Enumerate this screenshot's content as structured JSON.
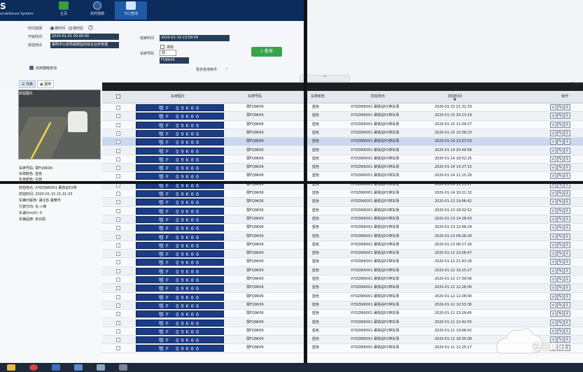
{
  "app": {
    "logo": "S",
    "subtitle": "urveillance System"
  },
  "nav": [
    {
      "label": "主页",
      "icon": "home-icon"
    },
    {
      "label": "实时视频",
      "icon": "camera-icon"
    },
    {
      "label": "卡口查询",
      "icon": "checkpoint-icon"
    }
  ],
  "search": {
    "time_select_label": "时间选择:",
    "radio_by_time": "按时间",
    "radio_by_segment": "按时段",
    "start_label": "开始时间",
    "start_value": "2020-01-01 00:00:00",
    "end_label": "结束时间",
    "end_value": "2020-01-19 23:59:59",
    "location_label": "抓拍地点",
    "location_value": "襄阳市公安局视频监控综合业务管理",
    "exclude_label": "排除",
    "plate_label": "车牌号码",
    "plate_prefix": "鄂",
    "plate_value": "FQ9K06",
    "fuzzy_label": "启用模糊查询",
    "more_conditions": "更多查询条件",
    "query_button": "查询"
  },
  "toolbar": {
    "tab_list": "列表",
    "tab_chart": "图表",
    "export": "导出所"
  },
  "preview": {
    "title": "抓拍图片"
  },
  "details_upper": [
    "车牌号码: 鄂FQ9K06",
    "车牌颜色: 蓝色",
    "车身颜色: 白色"
  ],
  "details_lower": [
    "抓拍地点: XYDZWK001 襄铁站P2停",
    "抓拍时间: 2020-01-15 21:31:33",
    "车辆归属地: 湖北省 襄樊市",
    "行驶方向: 东->西",
    "车速(km/h): 0",
    "车辆品牌: 未识别"
  ],
  "table": {
    "headers": [
      "车牌图片",
      "车牌号码",
      "车牌颜色",
      "抓拍地点",
      "抓拍时间",
      "操作"
    ],
    "plate_text": "鄂F Q9K06",
    "rows": [
      {
        "plate": "鄂FQ9K06",
        "color": "蓝色",
        "location": "XYDZWK001 襄铁站P2停车场",
        "time": "2020-01-15 21:31:33"
      },
      {
        "plate": "鄂FQ9K06",
        "color": "蓝色",
        "location": "XYDZWK001 襄铁站P2停车场",
        "time": "2020-01-15 20:13:19"
      },
      {
        "plate": "鄂FQ9K06",
        "color": "蓝色",
        "location": "XYDZWK001 襄铁站P2停车场",
        "time": "2020-01-15 11:09:27"
      },
      {
        "plate": "鄂FQ9K06",
        "color": "蓝色",
        "location": "XYDZWK001 襄铁站P2停车场",
        "time": "2020-01-15 10:38:23"
      },
      {
        "plate": "鄂FQ9K06",
        "color": "蓝色",
        "location": "XYDZWK001 襄铁站P2停车场",
        "time": "2020-01-14 23:07:53"
      },
      {
        "plate": "鄂FQ9K06",
        "color": "蓝色",
        "location": "XYDZWK001 襄铁站P2停车场",
        "time": "2020-01-14 20:49:58"
      },
      {
        "plate": "鄂FQ9K06",
        "color": "蓝色",
        "location": "XYDZWK001 襄铁站P2停车场",
        "time": "2020-01-14 18:52:25"
      },
      {
        "plate": "鄂FQ9K06",
        "color": "蓝色",
        "location": "XYDZWK001 襄铁站P2停车场",
        "time": "2020-01-14 14:27:15"
      },
      {
        "plate": "鄂FQ9K06",
        "color": "蓝色",
        "location": "XYDZWK001 襄铁站P2停车场",
        "time": "2020-01-14 11:15:16"
      },
      {
        "plate": "鄂FQ9K06",
        "color": "蓝色",
        "location": "XYDZWK001 襄铁站P2停车场",
        "time": "2020-01-14 11:13:17"
      },
      {
        "plate": "鄂FQ9K06",
        "color": "蓝色",
        "location": "XYDZWK001 襄铁站P2停车场",
        "time": "2020-01-14 10:21:32"
      },
      {
        "plate": "鄂FQ9K06",
        "color": "蓝色",
        "location": "XYDZWK001 襄铁站P2停车场",
        "time": "2020-01-13 19:06:42"
      },
      {
        "plate": "鄂FQ9K06",
        "color": "蓝色",
        "location": "XYDZWK001 襄铁站P2停车场",
        "time": "2020-01-13 18:02:52"
      },
      {
        "plate": "鄂FQ9K06",
        "color": "蓝色",
        "location": "XYDZWK001 襄铁站P2停车场",
        "time": "2020-01-13 14:28:43"
      },
      {
        "plate": "鄂FQ9K06",
        "color": "蓝色",
        "location": "XYDZWK001 襄铁站P2停车场",
        "time": "2020-01-13 13:48:24"
      },
      {
        "plate": "鄂FQ9K06",
        "color": "蓝色",
        "location": "XYDZWK001 襄铁站P2停车场",
        "time": "2020-01-13 09:28:28"
      },
      {
        "plate": "鄂FQ9K06",
        "color": "蓝色",
        "location": "XYDZWK001 襄铁站P2停车场",
        "time": "2020-01-13 08:17:26"
      },
      {
        "plate": "鄂FQ9K06",
        "color": "蓝色",
        "location": "XYDZWK001 襄铁站P2停车场",
        "time": "2020-01-12 23:06:47"
      },
      {
        "plate": "鄂FQ9K06",
        "color": "蓝色",
        "location": "XYDZWK001 襄铁站P2停车场",
        "time": "2020-01-12 21:43:28"
      },
      {
        "plate": "鄂FQ9K06",
        "color": "蓝色",
        "location": "XYDZWK001 襄铁站P2停车场",
        "time": "2020-01-12 19:15:27"
      },
      {
        "plate": "鄂FQ9K06",
        "color": "蓝色",
        "location": "XYDZWK001 襄铁站P2停车场",
        "time": "2020-01-12 17:39:56"
      },
      {
        "plate": "鄂FQ9K06",
        "color": "蓝色",
        "location": "XYDZWK001 襄铁站P2停车场",
        "time": "2020-01-12 12:28:00"
      },
      {
        "plate": "鄂FQ9K06",
        "color": "蓝色",
        "location": "XYDZWK001 襄铁站P2停车场",
        "time": "2020-01-12 12:28:00"
      },
      {
        "plate": "鄂FQ9K06",
        "color": "蓝色",
        "location": "XYDZWK001 襄铁站P2停车场",
        "time": "2020-01-12 10:53:36"
      },
      {
        "plate": "鄂FQ9K06",
        "color": "蓝色",
        "location": "XYDZWK001 襄铁站P2停车场",
        "time": "2020-01-11 23:29:45"
      },
      {
        "plate": "鄂FQ9K06",
        "color": "蓝色",
        "location": "XYDZWK001 襄铁站P2停车场",
        "time": "2020-01-11 22:42:55"
      },
      {
        "plate": "鄂FQ9K06",
        "color": "蓝色",
        "location": "XYDZWK001 襄铁站P2停车场",
        "time": "2020-01-11 19:08:42"
      },
      {
        "plate": "鄂FQ9K06",
        "color": "蓝色",
        "location": "XYDZWK001 襄铁站P2停车场",
        "time": "2020-01-11 18:35:08"
      },
      {
        "plate": "鄂FQ9K06",
        "color": "蓝色",
        "location": "XYDZWK001 襄铁站P2停车场",
        "time": "2020-01-11 12:25:17"
      }
    ]
  },
  "watermark": {
    "text": "云上襄阳"
  },
  "colors": {
    "header": "#0c2c5c",
    "query_button": "#3aa44a",
    "plate_blue": "#1b3c87",
    "selected_row": "#c8d8ee"
  }
}
